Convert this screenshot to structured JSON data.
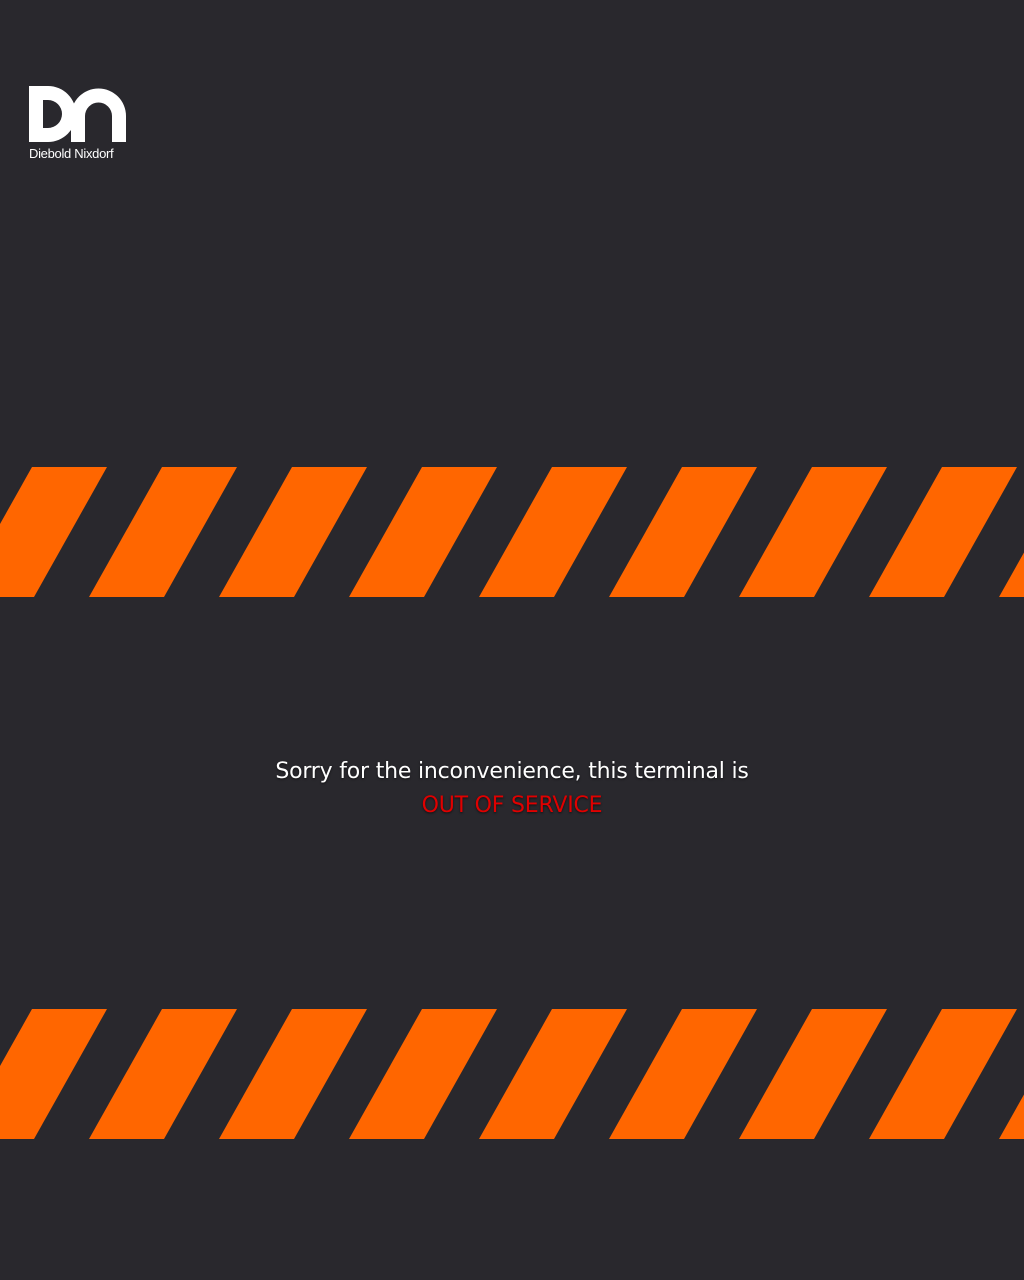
{
  "brand": {
    "name": "Diebold Nixdorf",
    "logo_icon": "dn-monogram-icon"
  },
  "message": {
    "line1": "Sorry for the inconvenience, this terminal is",
    "line2": "OUT OF SERVICE"
  },
  "colors": {
    "background": "#29282d",
    "stripe": "#ff6600",
    "text": "#ffffff",
    "status": "#e00000",
    "logo": "#ffffff"
  },
  "icons": {
    "stripe_band": "hazard-stripes"
  }
}
